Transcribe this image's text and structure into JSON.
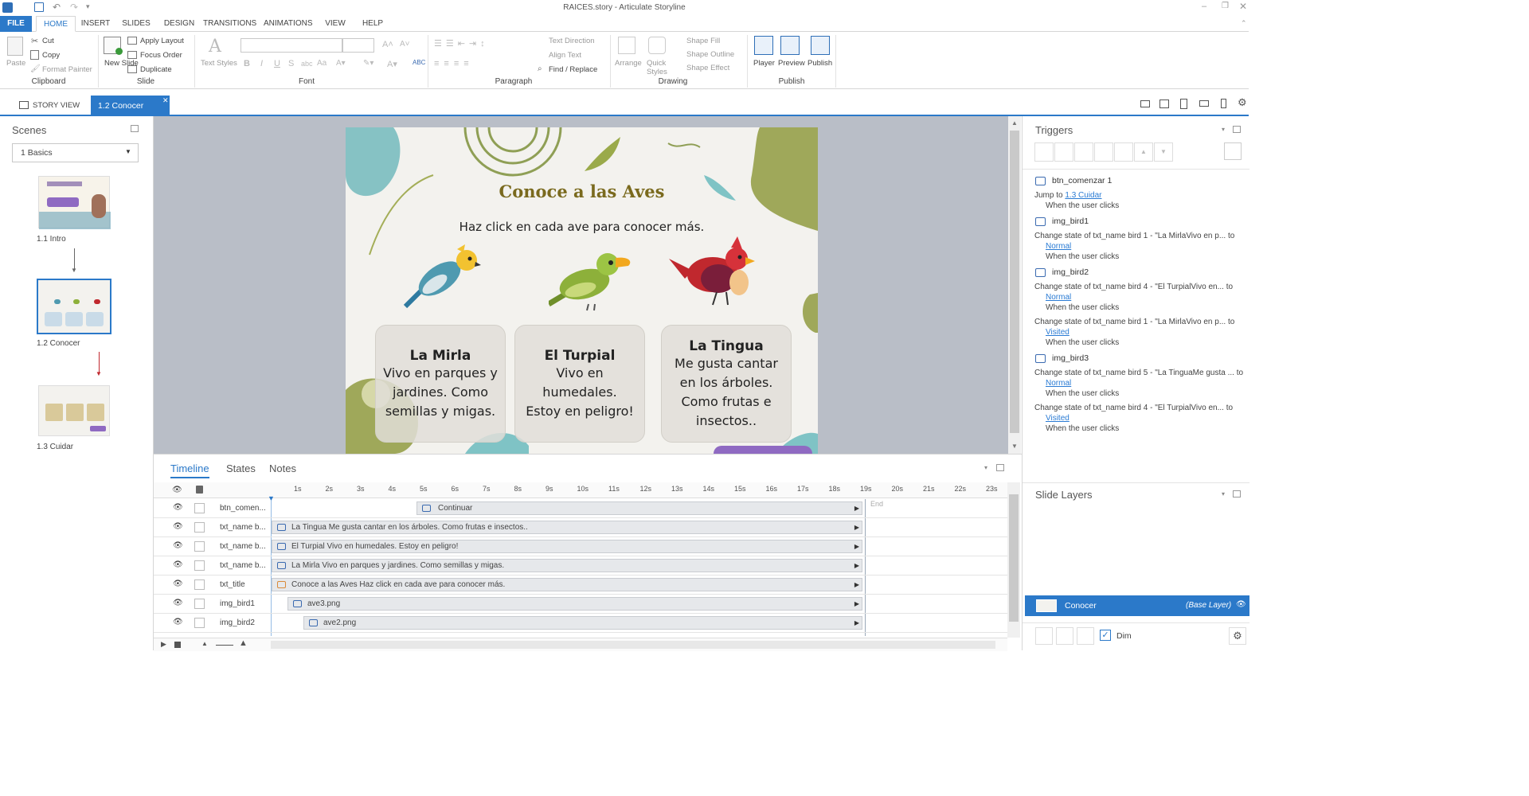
{
  "window": {
    "title": "RAICES.story - Articulate Storyline"
  },
  "menu": {
    "tabs": [
      "FILE",
      "HOME",
      "INSERT",
      "SLIDES",
      "DESIGN",
      "TRANSITIONS",
      "ANIMATIONS",
      "VIEW",
      "HELP"
    ]
  },
  "ribbon": {
    "clipboard": {
      "paste": "Paste",
      "cut": "Cut",
      "copy": "Copy",
      "format_painter": "Format Painter",
      "label": "Clipboard"
    },
    "slide": {
      "new_slide": "New Slide",
      "apply_layout": "Apply Layout",
      "focus_order": "Focus Order",
      "duplicate": "Duplicate",
      "label": "Slide"
    },
    "font": {
      "text_styles": "Text Styles",
      "label": "Font"
    },
    "paragraph": {
      "text_direction": "Text Direction",
      "align_text": "Align Text",
      "find_replace": "Find / Replace",
      "label": "Paragraph"
    },
    "drawing": {
      "arrange": "Arrange",
      "quick_styles": "Quick Styles",
      "shape_fill": "Shape Fill",
      "shape_outline": "Shape Outline",
      "shape_effect": "Shape Effect",
      "label": "Drawing"
    },
    "publish": {
      "player": "Player",
      "preview": "Preview",
      "publish": "Publish",
      "label": "Publish"
    }
  },
  "docbar": {
    "story_view": "STORY VIEW",
    "active_tab": "1.2 Conocer"
  },
  "scenes": {
    "title": "Scenes",
    "selector": "1 Basics",
    "slides": [
      {
        "label": "1.1 Intro"
      },
      {
        "label": "1.2 Conocer"
      },
      {
        "label": "1.3 Cuidar"
      }
    ]
  },
  "slide": {
    "title": "Conoce a las Aves",
    "subtitle": "Haz click en cada ave para conocer más.",
    "cards": [
      {
        "name": "La Mirla",
        "text": [
          "Vivo en parques y",
          "jardines. Como",
          "semillas y migas."
        ]
      },
      {
        "name": "El Turpial",
        "text": [
          "Vivo en",
          "humedales.",
          "Estoy en peligro!"
        ]
      },
      {
        "name": "La Tingua",
        "text": [
          "Me gusta cantar",
          "en los árboles.",
          "Como frutas e",
          "insectos.."
        ]
      }
    ]
  },
  "timeline": {
    "tabs": [
      "Timeline",
      "States",
      "Notes"
    ],
    "ticks": [
      "1s",
      "2s",
      "3s",
      "4s",
      "5s",
      "6s",
      "7s",
      "8s",
      "9s",
      "10s",
      "11s",
      "12s",
      "13s",
      "14s",
      "15s",
      "16s",
      "17s",
      "18s",
      "19s",
      "20s",
      "21s",
      "22s",
      "23s"
    ],
    "end_label": "End",
    "rows": [
      {
        "name": "btn_comen...",
        "bar": "Continuar"
      },
      {
        "name": "txt_name b...",
        "bar": "La Tingua Me gusta cantar en los árboles. Como frutas e insectos.."
      },
      {
        "name": "txt_name b...",
        "bar": "El Turpial Vivo en humedales. Estoy en peligro!"
      },
      {
        "name": "txt_name b...",
        "bar": "La Mirla Vivo en parques y jardines. Como semillas y migas."
      },
      {
        "name": "txt_title",
        "bar": "Conoce a las Aves Haz click en cada ave para conocer más."
      },
      {
        "name": "img_bird1",
        "bar": "ave3.png"
      },
      {
        "name": "img_bird2",
        "bar": "ave2.png"
      }
    ]
  },
  "triggers": {
    "title": "Triggers",
    "groups": [
      {
        "object": "btn_comenzar 1",
        "items": [
          {
            "action": "Jump to ",
            "target": "1.3 Cuidar",
            "inline": true,
            "when": "When the user clicks"
          }
        ]
      },
      {
        "object": "img_bird1",
        "items": [
          {
            "action": "Change state of txt_name bird 1 - \"La MirlaVivo en p... to",
            "target": "Normal",
            "when": "When the user clicks"
          }
        ]
      },
      {
        "object": "img_bird2",
        "items": [
          {
            "action": "Change state of txt_name bird 4 - \"El TurpialVivo en... to",
            "target": "Normal",
            "when": "When the user clicks"
          },
          {
            "action": "Change state of txt_name bird 1 - \"La MirlaVivo en p... to",
            "target": "Visited",
            "when": "When the user clicks"
          }
        ]
      },
      {
        "object": "img_bird3",
        "items": [
          {
            "action": "Change state of txt_name bird 5 - \"La TinguaMe gusta ... to",
            "target": "Normal",
            "when": "When the user clicks"
          },
          {
            "action": "Change state of txt_name bird 4 - \"El TurpialVivo en... to",
            "target": "Visited",
            "when": "When the user clicks"
          }
        ]
      }
    ]
  },
  "layers": {
    "title": "Slide Layers",
    "base": {
      "name": "Conocer",
      "tag": "(Base Layer)"
    },
    "dim": "Dim"
  },
  "colors": {
    "accent": "#2b79c9",
    "title_olive": "#7a6a1e"
  }
}
